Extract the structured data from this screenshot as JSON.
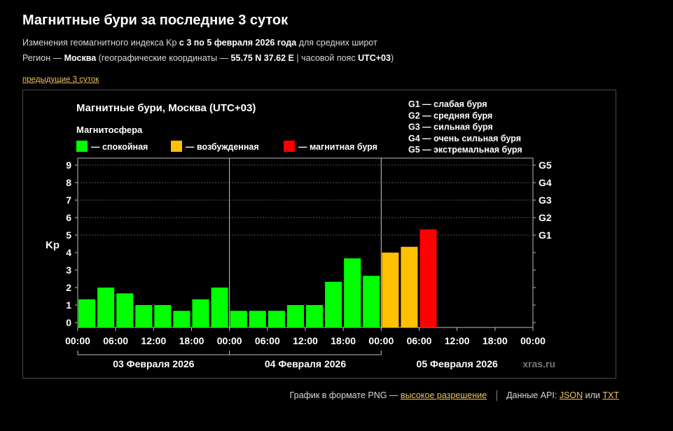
{
  "page": {
    "title": "Магнитные бури за последние 3 суток",
    "subtitle_prefix": "Изменения геомагнитного индекса Kp",
    "subtitle_period": "с 3 по 5 февраля 2026 года",
    "subtitle_suffix": "для средних широт",
    "region_prefix": "Регион —",
    "region_city": "Москва",
    "coords_prefix": "(географические координаты —",
    "coords_value": "55.75 N 37.62 E",
    "tz_prefix": "| часовой пояс",
    "tz_value": "UTC+03",
    "tz_close": ")",
    "prev_link": "предыдущие 3 суток"
  },
  "footer": {
    "png_text": "График в формате PNG —",
    "hires_link": "высокое разрешение",
    "api_text": "Данные API:",
    "json_link": "JSON",
    "or_text": "или",
    "txt_link": "TXT"
  },
  "colors": {
    "quiet": "#00ff00",
    "active": "#ffc000",
    "storm": "#ff0000",
    "background": "#000000",
    "grid": "#555555"
  },
  "chart_data": {
    "type": "bar",
    "title": "Магнитные бури, Москва (UTC+03)",
    "legend_title": "Магнитосфера",
    "legend": [
      {
        "label": "— спокойная",
        "color": "#00ff00"
      },
      {
        "label": "— возбужденная",
        "color": "#ffc000"
      },
      {
        "label": "— магнитная буря",
        "color": "#ff0000"
      }
    ],
    "storm_scale": [
      "G1 — слабая буря",
      "G2 — средняя буря",
      "G3 — сильная буря",
      "G4 — очень сильная буря",
      "G5 — экстремальная буря"
    ],
    "ylabel": "Kp",
    "ylim": [
      0,
      9
    ],
    "yticks": [
      "0",
      "1",
      "2",
      "3",
      "4",
      "5",
      "6",
      "7",
      "8",
      "9"
    ],
    "right_ticks": [
      {
        "label": "G1",
        "kp": 5
      },
      {
        "label": "G2",
        "kp": 6
      },
      {
        "label": "G3",
        "kp": 7
      },
      {
        "label": "G4",
        "kp": 8
      },
      {
        "label": "G5",
        "kp": 9
      }
    ],
    "xticks": [
      "00:00",
      "06:00",
      "12:00",
      "18:00",
      "00:00",
      "06:00",
      "12:00",
      "18:00",
      "00:00",
      "06:00",
      "12:00",
      "18:00",
      "00:00"
    ],
    "days": [
      "03 Февраля 2026",
      "04 Февраля 2026",
      "05 Февраля 2026"
    ],
    "slots_total": 24,
    "values": [
      1.33,
      2.0,
      1.67,
      1.0,
      1.0,
      0.67,
      1.33,
      2.0,
      0.67,
      0.67,
      0.67,
      1.0,
      1.0,
      2.33,
      3.67,
      2.67,
      4.0,
      4.33,
      5.33
    ],
    "levels": [
      "quiet",
      "quiet",
      "quiet",
      "quiet",
      "quiet",
      "quiet",
      "quiet",
      "quiet",
      "quiet",
      "quiet",
      "quiet",
      "quiet",
      "quiet",
      "quiet",
      "quiet",
      "quiet",
      "active",
      "active",
      "storm"
    ],
    "watermark": "xras.ru",
    "grid": true
  }
}
